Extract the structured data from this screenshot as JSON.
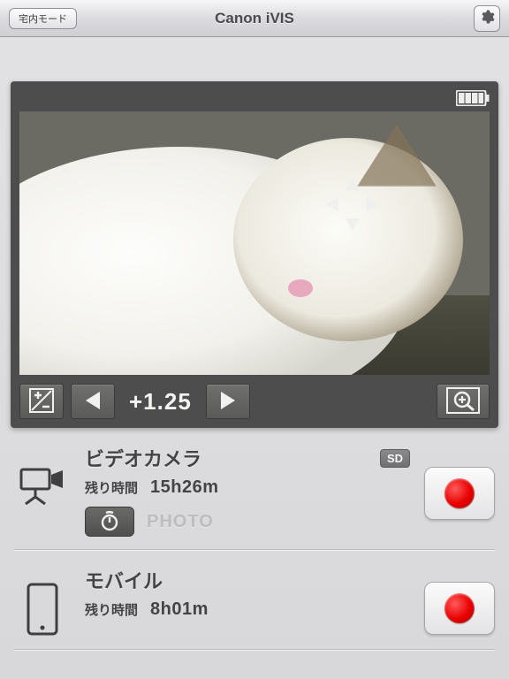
{
  "header": {
    "mode_button": "宅内モード",
    "title": "Canon iVIS",
    "settings_icon": "gear-icon"
  },
  "viewfinder": {
    "battery_level": "full",
    "focus_marker": "center",
    "ev": {
      "toggle_icon": "plus-minus-icon",
      "value": "+1.25",
      "prev_icon": "triangle-left",
      "next_icon": "triangle-right",
      "zoom_icon": "magnify-plus-icon"
    }
  },
  "devices": {
    "camera": {
      "title": "ビデオカメラ",
      "storage_badge": "SD",
      "remain_label": "残り時間",
      "remain_value": "15h26m",
      "timer_icon": "self-timer-icon",
      "photo_label": "PHOTO",
      "record_icon": "record-icon"
    },
    "mobile": {
      "title": "モバイル",
      "remain_label": "残り時間",
      "remain_value": "8h01m",
      "record_icon": "record-icon"
    }
  }
}
